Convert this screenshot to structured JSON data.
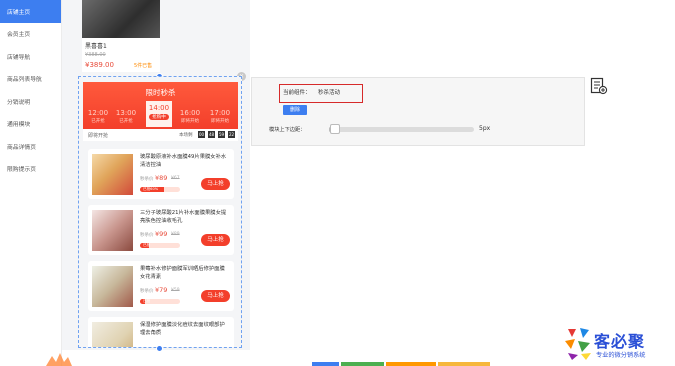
{
  "sidebar": {
    "items": [
      {
        "label": "店铺主页",
        "active": true
      },
      {
        "label": "会员主页",
        "active": false
      },
      {
        "label": "店铺导航",
        "active": false
      },
      {
        "label": "商品列表导航",
        "active": false
      },
      {
        "label": "分销说明",
        "active": false
      },
      {
        "label": "通用模块",
        "active": false
      },
      {
        "label": "商品详情页",
        "active": false
      },
      {
        "label": "限购提示页",
        "active": false
      }
    ]
  },
  "top_product": {
    "name": "黑喜喜1",
    "original_price": "¥388.00",
    "price": "¥389.00",
    "sold": "5件已售"
  },
  "flash_sale": {
    "title": "限时秒杀",
    "times": [
      {
        "time": "12:00",
        "status": "已开抢",
        "active": false
      },
      {
        "time": "13:00",
        "status": "已开抢",
        "active": false
      },
      {
        "time": "14:00",
        "status": "抢购中",
        "active": true
      },
      {
        "time": "16:00",
        "status": "即将开始",
        "active": false
      },
      {
        "time": "17:00",
        "status": "即将开始",
        "active": false
      }
    ],
    "countdown_left": "即将开抢",
    "countdown_right": "本场剩",
    "countdown": [
      "00",
      "48",
      "59",
      "22"
    ],
    "items": [
      {
        "title": "玻尿酸原液补水面膜49片果膜女补水清洁控油",
        "pre": "秒杀价",
        "price": "¥89",
        "orig": "¥67",
        "progress_label": "已抢60%",
        "progress": 0.6,
        "buy": "马上抢"
      },
      {
        "title": "三分子玻尿酸21片补水面膜果膜女提亮肤色控油收毛孔",
        "pre": "秒杀价",
        "price": "¥99",
        "orig": "¥89",
        "progress_label": "已抢",
        "progress": 0.22,
        "buy": "马上抢"
      },
      {
        "title": "果莓补水修护面膜军训晒后修护面膜女花青素",
        "pre": "秒杀价",
        "price": "¥79",
        "orig": "¥59",
        "progress_label": "已抢",
        "progress": 0.12,
        "buy": "马上抢"
      },
      {
        "title": "保湿修护面膜淡化痘纹去面纹眼部护理去角质",
        "pre": "",
        "price": "",
        "orig": "",
        "progress_label": "",
        "progress": 0,
        "buy": ""
      }
    ]
  },
  "settings_panel": {
    "current_component_label": "当前组件：",
    "current_component_value": "秒杀活动",
    "delete_button": "删除",
    "margin_label": "模块上下边距：",
    "margin_value": "5px",
    "margin_fraction": 0.02
  },
  "brand": {
    "name": "客必聚",
    "subtitle": "专业的微分销系统"
  },
  "colors": {
    "accent": "#3d7ef0",
    "flash_red": "#f33f2b",
    "highlight_border": "#d62a2a",
    "brand_blue": "#2a4fd6"
  }
}
